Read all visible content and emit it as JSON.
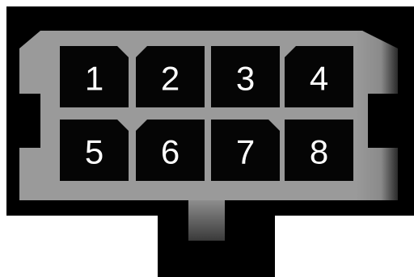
{
  "connector": {
    "pins": [
      {
        "label": "1",
        "shape": "top-right-chamfer"
      },
      {
        "label": "2",
        "shape": "top-left-chamfer"
      },
      {
        "label": "3",
        "shape": "square"
      },
      {
        "label": "4",
        "shape": "top-left-chamfer"
      },
      {
        "label": "5",
        "shape": "top-right-chamfer"
      },
      {
        "label": "6",
        "shape": "top-left-chamfer"
      },
      {
        "label": "7",
        "shape": "top-right-chamfer"
      },
      {
        "label": "8",
        "shape": "square"
      }
    ],
    "colors": {
      "background": "#000000",
      "housing": "#9a9a9a",
      "housing_edge": "#7a7a7a",
      "pin_cavity": "#050505",
      "pin_label": "#ffffff",
      "cable": "#000000",
      "page": "#ffffff"
    }
  }
}
